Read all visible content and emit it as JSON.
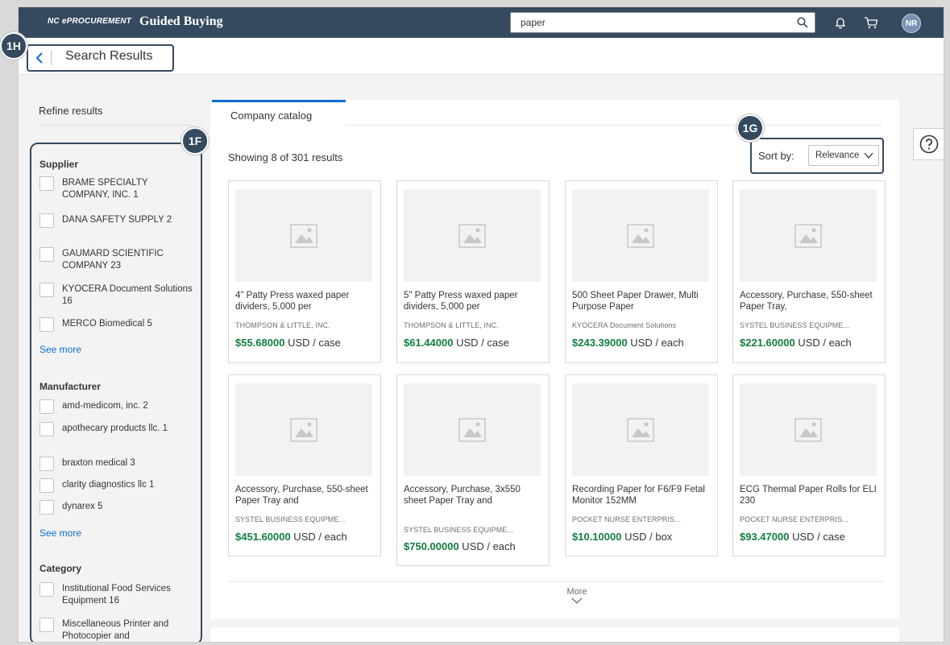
{
  "shell": {
    "brand_prefix": "NC ePROCUREMENT",
    "brand_title": "Guided Buying",
    "search_value": "paper",
    "avatar_initials": "NR",
    "icons": [
      "search-icon",
      "bell-icon",
      "cart-icon"
    ]
  },
  "header": {
    "page_title": "Search Results"
  },
  "callouts": {
    "h": "1H",
    "f": "1F",
    "g": "1G"
  },
  "sidebar": {
    "title": "Refine results",
    "see_more_label": "See more",
    "supplier": {
      "heading": "Supplier",
      "items": [
        {
          "label": "BRAME SPECIALTY COMPANY, INC.  1"
        },
        {
          "label": "DANA SAFETY SUPPLY  2"
        },
        {
          "label": "GAUMARD SCIENTIFIC COMPANY  23"
        },
        {
          "label": "KYOCERA Document Solutions  16"
        },
        {
          "label": "MERCO Biomedical  5"
        }
      ]
    },
    "manufacturer": {
      "heading": "Manufacturer",
      "items": [
        {
          "label": "amd-medicom, inc.  2"
        },
        {
          "label": "apothecary products llc.  1"
        },
        {
          "label": "braxton medical  3"
        },
        {
          "label": "clarity diagnostics llc  1"
        },
        {
          "label": "dynarex  5"
        }
      ]
    },
    "category": {
      "heading": "Category",
      "items": [
        {
          "label": "Institutional Food Services Equipment  16"
        },
        {
          "label": "Miscellaneous Printer and Photocopier and"
        }
      ]
    }
  },
  "main": {
    "tab_label": "Company catalog",
    "showing_text": "Showing 8 of 301 results",
    "sort_label": "Sort by:",
    "sort_value": "Relevance",
    "more_label": "More",
    "products": [
      {
        "name": "4\" Patty Press waxed paper dividers, 5,000 per",
        "supplier": "THOMPSON & LITTLE, INC.",
        "price": "$55.68000",
        "unit": " USD / case"
      },
      {
        "name": "5\" Patty Press waxed paper dividers, 5,000 per",
        "supplier": "THOMPSON & LITTLE, INC.",
        "price": "$61.44000",
        "unit": " USD / case"
      },
      {
        "name": "500 Sheet Paper Drawer, Multi Purpose Paper",
        "supplier": "KYOCERA Document Solutions",
        "price": "$243.39000",
        "unit": " USD / each"
      },
      {
        "name": "Accessory, Purchase, 550-sheet Paper Tray,",
        "supplier": "SYSTEL BUSINESS EQUIPME...",
        "price": "$221.60000",
        "unit": " USD / each"
      },
      {
        "name": "Accessory, Purchase, 550-sheet Paper Tray and",
        "supplier": "SYSTEL BUSINESS EQUIPME...",
        "price": "$451.60000",
        "unit": " USD / each"
      },
      {
        "name": "Accessory, Purchase, 3x550 sheet Paper Tray and",
        "supplier": "SYSTEL BUSINESS EQUIPME...",
        "price": "$750.00000",
        "unit": " USD / each"
      },
      {
        "name": "Recording Paper for F6/F9 Fetal Monitor 152MM",
        "supplier": "POCKET NURSE ENTERPRIS...",
        "price": "$10.10000",
        "unit": " USD / box"
      },
      {
        "name": "ECG Thermal Paper Rolls for ELI 230",
        "supplier": "POCKET NURSE ENTERPRIS...",
        "price": "$93.47000",
        "unit": " USD / case"
      }
    ]
  },
  "help_icon": "help-icon",
  "colors": {
    "shell": "#354a5f",
    "accent": "#0a6ed1",
    "price": "#107e3e"
  }
}
